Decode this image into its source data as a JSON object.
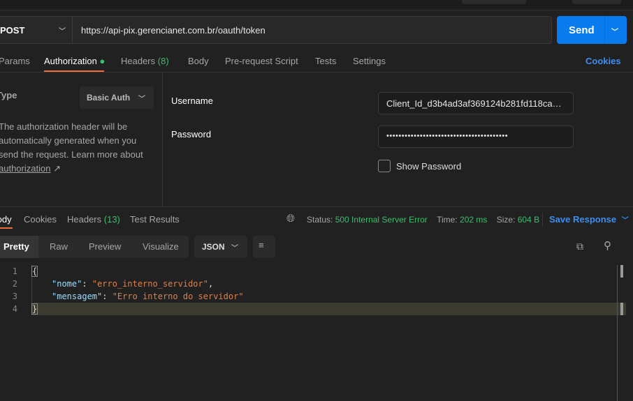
{
  "request": {
    "method": "POST",
    "url": "https://api-pix.gerencianet.com.br/oauth/token",
    "send_label": "Send"
  },
  "req_tabs": [
    {
      "label": "Params"
    },
    {
      "label": "Authorization"
    },
    {
      "label": "Headers",
      "count": "(8)"
    },
    {
      "label": "Body"
    },
    {
      "label": "Pre-request Script"
    },
    {
      "label": "Tests"
    },
    {
      "label": "Settings"
    }
  ],
  "cookies_link": "Cookies",
  "auth": {
    "type_label": "Type",
    "type_value": "Basic Auth",
    "description": "The authorization header will be automatically generated when you send the request. Learn more about",
    "link": "authorization",
    "username_label": "Username",
    "username_value": "Client_Id_d3b4ad3af369124b281fd118ca92...",
    "password_label": "Password",
    "password_value": "••••••••••••••••••••••••••••••••••••••••",
    "show_password": "Show Password"
  },
  "resp_tabs": [
    {
      "label": "Body"
    },
    {
      "label": "Cookies"
    },
    {
      "label": "Headers",
      "count": "(13)"
    },
    {
      "label": "Test Results"
    }
  ],
  "status": {
    "status_label": "Status:",
    "status_value": "500 Internal Server Error",
    "time_label": "Time:",
    "time_value": "202 ms",
    "size_label": "Size:",
    "size_value": "604 B",
    "save": "Save Response"
  },
  "views": [
    "Pretty",
    "Raw",
    "Preview",
    "Visualize"
  ],
  "format": "JSON",
  "code": {
    "lines": [
      "1",
      "2",
      "3",
      "4"
    ],
    "l1": "{",
    "k1": "\"nome\"",
    "v1": "\"erro_interno_servidor\"",
    "k2": "\"mensagem\"",
    "v2": "\"Erro interno do servidor\"",
    "l4": "}"
  },
  "colors": {
    "accent": "#097bed",
    "status_ok": "#3fbd6e",
    "tab_underline": "#f26b3a"
  }
}
